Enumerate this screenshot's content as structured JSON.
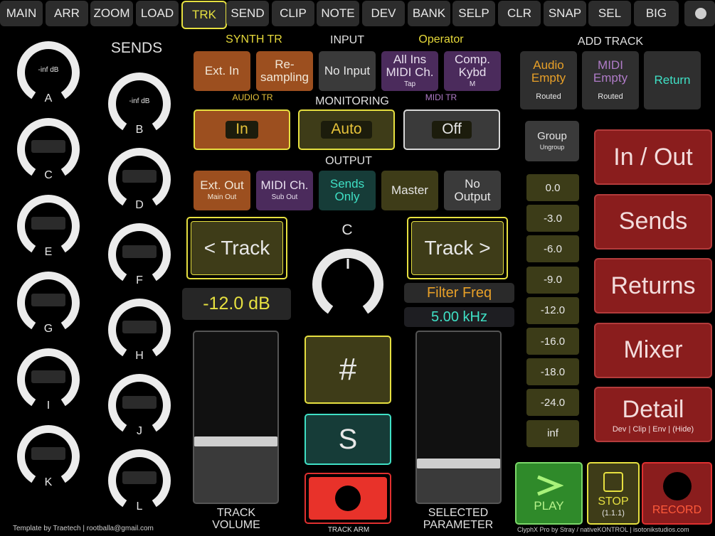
{
  "nav": [
    "MAIN",
    "ARR",
    "ZOOM",
    "LOAD",
    "TRK",
    "SEND",
    "CLIP",
    "NOTE",
    "DEV",
    "BANK",
    "SELP",
    "CLR",
    "SNAP",
    "SEL",
    "BIG"
  ],
  "nav_active": "TRK",
  "sends_title": "SENDS",
  "knobs_left": [
    {
      "label": "A",
      "value": "-inf dB"
    },
    {
      "label": "C",
      "value": ""
    },
    {
      "label": "E",
      "value": ""
    },
    {
      "label": "G",
      "value": ""
    },
    {
      "label": "I",
      "value": ""
    },
    {
      "label": "K",
      "value": ""
    }
  ],
  "knobs_right": [
    {
      "label": "B",
      "value": "-inf dB"
    },
    {
      "label": "D",
      "value": ""
    },
    {
      "label": "F",
      "value": ""
    },
    {
      "label": "H",
      "value": ""
    },
    {
      "label": "J",
      "value": ""
    },
    {
      "label": "L",
      "value": ""
    }
  ],
  "headers": {
    "synth_tr": "SYNTH TR",
    "input": "INPUT",
    "operator": "Operator",
    "add_track": "ADD TRACK",
    "audio_tr": "AUDIO TR",
    "monitoring": "MONITORING",
    "midi_tr": "MIDI TR",
    "output": "OUTPUT"
  },
  "input_buttons": {
    "ext_in": "Ext. In",
    "resampling": "Re-\nsampling",
    "no_input": "No Input",
    "all_ins": "All Ins\nMIDI Ch.",
    "all_ins_sub": "Tap",
    "comp_kybd": "Comp.\nKybd",
    "comp_kybd_sub": "M"
  },
  "add_track": {
    "audio": "Audio\nEmpty",
    "audio_sub": "Routed",
    "midi": "MIDI\nEmpty",
    "midi_sub": "Routed",
    "return": "Return"
  },
  "monitoring": {
    "in": "In",
    "auto": "Auto",
    "off": "Off"
  },
  "group": {
    "label": "Group",
    "sub": "Ungroup"
  },
  "output_buttons": {
    "ext_out": "Ext. Out",
    "ext_out_sub": "Main Out",
    "midi_ch": "MIDI Ch.",
    "midi_ch_sub": "Sub Out",
    "sends_only": "Sends\nOnly",
    "master": "Master",
    "no_output": "No\nOutput"
  },
  "track_nav": {
    "prev": "< Track",
    "next": "Track >"
  },
  "center_knob_label": "C",
  "volume_readout": "-12.0 dB",
  "param_name": "Filter Freq",
  "param_value": "5.00 kHz",
  "hash_label": "#",
  "solo_label": "S",
  "track_volume_label": "TRACK\nVOLUME",
  "track_arm_label": "TRACK ARM",
  "selected_param_label": "SELECTED\nPARAMETER",
  "volume_fader_level": 0.36,
  "param_fader_level": 0.23,
  "db_buttons": [
    "0.0",
    "-3.0",
    "-6.0",
    "-9.0",
    "-12.0",
    "-16.0",
    "-18.0",
    "-24.0",
    "inf"
  ],
  "right_panel": [
    {
      "label": "In / Out",
      "sub": ""
    },
    {
      "label": "Sends",
      "sub": ""
    },
    {
      "label": "Returns",
      "sub": ""
    },
    {
      "label": "Mixer",
      "sub": ""
    },
    {
      "label": "Detail",
      "sub": "Dev | Clip | Env | (Hide)"
    }
  ],
  "transport": {
    "play": "PLAY",
    "stop": "STOP",
    "stop_sub": "(1.1.1)",
    "record": "RECORD"
  },
  "footer_left": "Template by Traetech | rootballa@gmail.com",
  "footer_right": "ClyphX Pro by Stray / nativeKONTROL  |  isotonikstudios.com",
  "colors": {
    "accent": "#e6e040",
    "orange": "#9c4f1f",
    "purple": "#4b2b5c",
    "red": "#8c1e1e",
    "teal_text": "#3fe0c5",
    "play_green": "#2f8a2a"
  }
}
